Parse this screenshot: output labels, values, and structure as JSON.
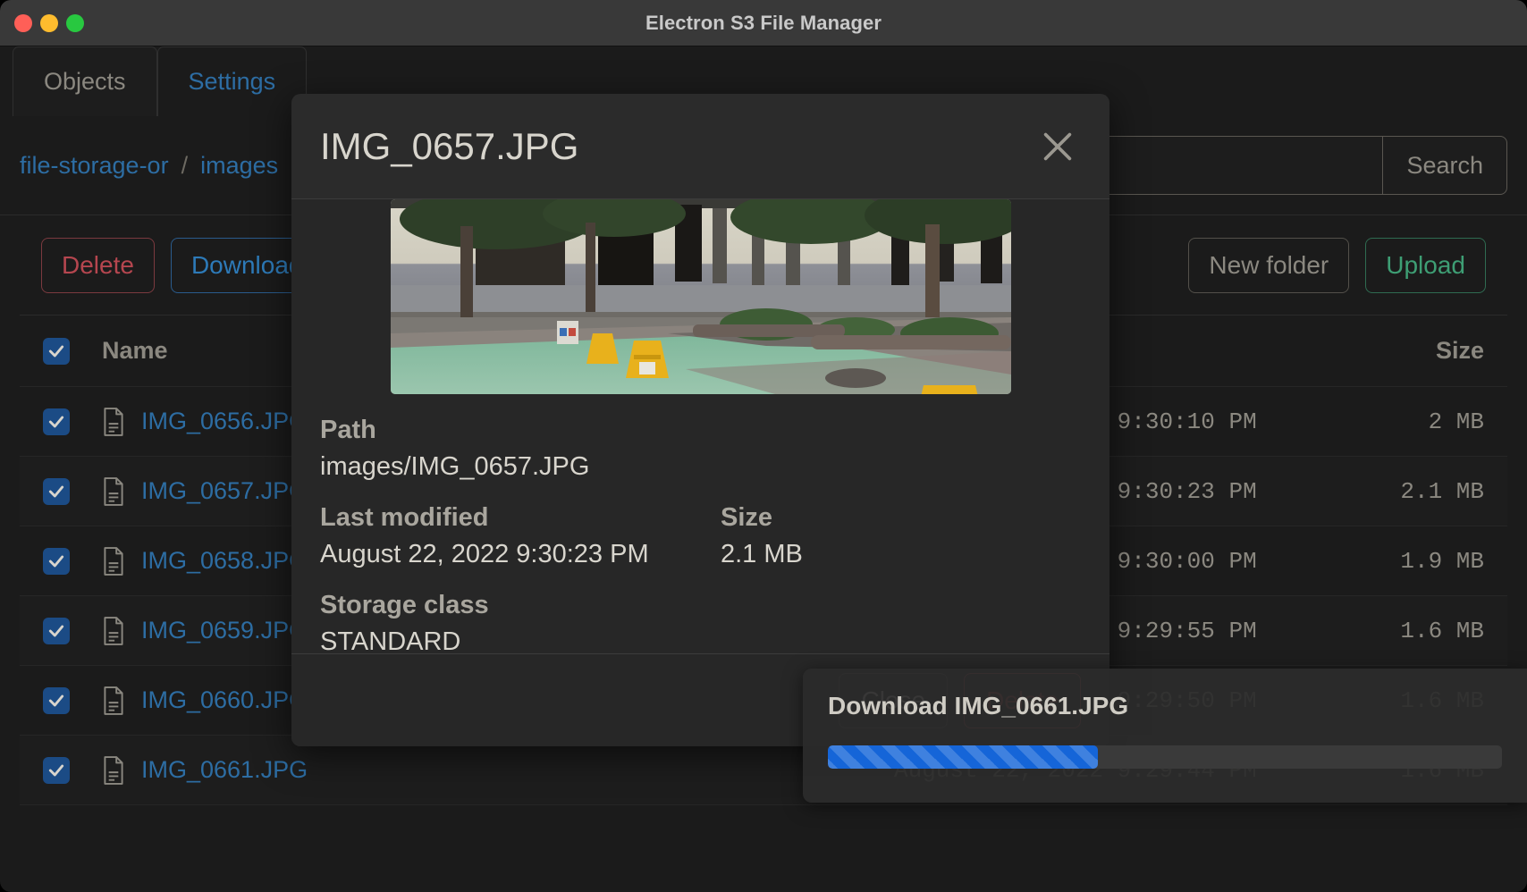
{
  "window": {
    "title": "Electron S3 File Manager",
    "traffic_lights": [
      "close",
      "minimize",
      "zoom"
    ]
  },
  "tabs": [
    {
      "label": "Objects",
      "active": true
    },
    {
      "label": "Settings",
      "active": false
    }
  ],
  "breadcrumb": {
    "items": [
      "file-storage-or",
      "images"
    ],
    "separator": "/"
  },
  "search": {
    "value": "",
    "placeholder": "",
    "button_label": "Search"
  },
  "toolbar": {
    "delete_label": "Delete",
    "download_label": "Download",
    "new_folder_label": "New folder",
    "upload_label": "Upload"
  },
  "table": {
    "headers": {
      "name": "Name",
      "size": "Size"
    },
    "select_all_checked": true,
    "rows": [
      {
        "name": "IMG_0656.JPG",
        "date": "August 22, 2022 9:30:10 PM",
        "size": "2 MB",
        "checked": true
      },
      {
        "name": "IMG_0657.JPG",
        "date": "August 22, 2022 9:30:23 PM",
        "size": "2.1 MB",
        "checked": true
      },
      {
        "name": "IMG_0658.JPG",
        "date": "August 22, 2022 9:30:00 PM",
        "size": "1.9 MB",
        "checked": true
      },
      {
        "name": "IMG_0659.JPG",
        "date": "August 22, 2022 9:29:55 PM",
        "size": "1.6 MB",
        "checked": true
      },
      {
        "name": "IMG_0660.JPG",
        "date": "August 22, 2022 9:29:50 PM",
        "size": "1.6 MB",
        "checked": true
      },
      {
        "name": "IMG_0661.JPG",
        "date": "August 22, 2022 9:29:44 PM",
        "size": "1.6 MB",
        "checked": true
      }
    ]
  },
  "modal": {
    "title": "IMG_0657.JPG",
    "close_icon": "close-icon",
    "preview_alt": "courtyard with yellow traffic barriers on green pavement",
    "fields": {
      "path_label": "Path",
      "path_value": "images/IMG_0657.JPG",
      "last_modified_label": "Last modified",
      "last_modified_value": "August 22, 2022 9:30:23 PM",
      "size_label": "Size",
      "size_value": "2.1 MB",
      "storage_class_label": "Storage class",
      "storage_class_value": "STANDARD"
    },
    "buttons": {
      "close_label": "Close",
      "delete_label": "Delete"
    }
  },
  "toast": {
    "title": "Download IMG_0661.JPG",
    "progress_percent": 40
  },
  "colors": {
    "accent_link": "#2d6da3",
    "danger": "#b5464f",
    "success": "#3e9e74",
    "progress": "#1565d8",
    "page_bg": "#1b1b1b",
    "titlebar_bg": "#393939",
    "modal_bg": "#2b2b2b",
    "text_muted": "#8b8880",
    "text_primary": "#d8d5cd"
  }
}
